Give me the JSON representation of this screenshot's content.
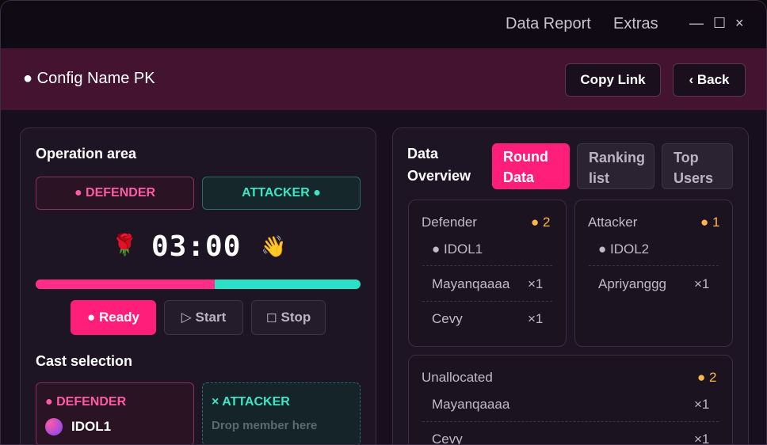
{
  "titlebar": {
    "menus": [
      "Data Report",
      "Extras"
    ],
    "controls": {
      "minimize": "—",
      "maximize": "☐",
      "close": "×"
    }
  },
  "header": {
    "config_name": "● Config Name PK",
    "copy_link": "Copy Link",
    "back": "‹ Back"
  },
  "operation": {
    "title": "Operation area",
    "defender_label": "● DEFENDER",
    "attacker_label": "ATTACKER ●",
    "timer": "03:00",
    "emoji_left": "🌹",
    "emoji_right": "👋",
    "progress_defender_fraction": 0.55,
    "buttons": {
      "ready": "● Ready",
      "start": "▷ Start",
      "stop": "◻ Stop"
    }
  },
  "cast": {
    "title": "Cast selection",
    "defender_label": "● DEFENDER",
    "defender_member": "IDOL1",
    "attacker_label": "× ATTACKER",
    "attacker_placeholder": "Drop member here"
  },
  "overview": {
    "title_line1": "Data",
    "title_line2": "Overview",
    "tabs": [
      {
        "line1": "Round",
        "line2": "Data"
      },
      {
        "line1": "Ranking",
        "line2": "list"
      },
      {
        "line1": "Top",
        "line2": "Users"
      }
    ],
    "defender": {
      "label": "Defender",
      "count": "● 2",
      "idol": "● IDOL1",
      "members": [
        {
          "name": "Mayanqaaaa",
          "qty": "×1"
        },
        {
          "name": "Cevy",
          "qty": "×1"
        }
      ]
    },
    "attacker": {
      "label": "Attacker",
      "count": "● 1",
      "idol": "● IDOL2",
      "members": [
        {
          "name": "Apriyanggg",
          "qty": "×1"
        }
      ]
    },
    "unallocated": {
      "label": "Unallocated",
      "count": "● 2",
      "members": [
        {
          "name": "Mayanqaaaa",
          "qty": "×1"
        },
        {
          "name": "Cevy",
          "qty": "×1"
        }
      ]
    }
  },
  "colors": {
    "accent_pink": "#ff1f7a",
    "accent_teal": "#2ae0c7",
    "count_orange": "#ffb54a",
    "header_bg": "#44132f"
  }
}
